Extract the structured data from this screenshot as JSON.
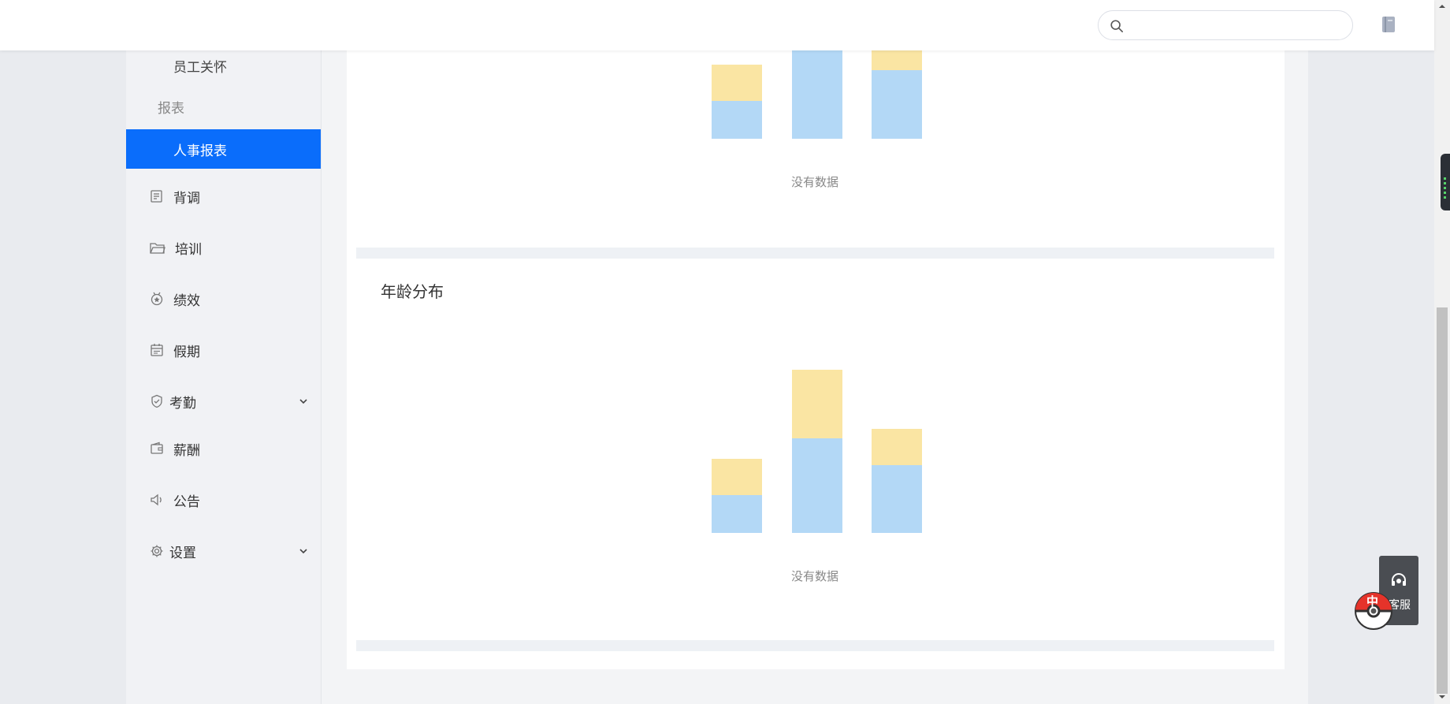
{
  "header": {
    "search_placeholder": ""
  },
  "sidebar": {
    "sub_item": "员工关怀",
    "group_label": "报表",
    "active_item": "人事报表",
    "items": [
      {
        "label": "背调",
        "icon": "form-icon"
      },
      {
        "label": "培训",
        "icon": "folder-icon"
      },
      {
        "label": "绩效",
        "icon": "medal-icon"
      },
      {
        "label": "假期",
        "icon": "calendar-icon"
      },
      {
        "label": "考勤",
        "icon": "shield-check-icon",
        "expandable": true
      },
      {
        "label": "薪酬",
        "icon": "wallet-icon"
      },
      {
        "label": "公告",
        "icon": "speaker-icon"
      },
      {
        "label": "设置",
        "icon": "gear-icon",
        "expandable": true
      }
    ]
  },
  "cards": [
    {
      "title": "",
      "empty_text": "没有数据"
    },
    {
      "title": "年龄分布",
      "empty_text": "没有数据"
    }
  ],
  "floating": {
    "kefu_label": "客服",
    "ball_label": "中"
  },
  "colors": {
    "accent": "#0a6dfb",
    "placeholder_bar_top": "#fae5a3",
    "placeholder_bar_bottom": "#b3d8f6"
  }
}
